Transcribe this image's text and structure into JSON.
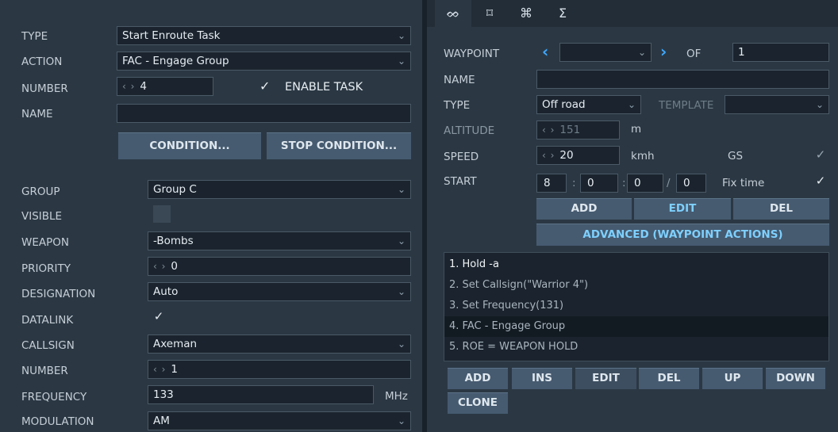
{
  "left": {
    "type": {
      "label": "TYPE",
      "value": "Start Enroute Task"
    },
    "action": {
      "label": "ACTION",
      "value": "FAC - Engage Group"
    },
    "number": {
      "label": "NUMBER",
      "spin": "‹ ›",
      "value": "4"
    },
    "enable_task": {
      "label": "ENABLE TASK",
      "checked": true
    },
    "name": {
      "label": "NAME",
      "value": ""
    },
    "condition_button": "CONDITION...",
    "stop_condition_button": "STOP CONDITION...",
    "group": {
      "label": "GROUP",
      "value": "Group C"
    },
    "visible": {
      "label": "VISIBLE",
      "checked": false
    },
    "weapon": {
      "label": "WEAPON",
      "value": "-Bombs"
    },
    "priority": {
      "label": "PRIORITY",
      "spin": "‹ ›",
      "value": "0"
    },
    "designation": {
      "label": "DESIGNATION",
      "value": "Auto"
    },
    "datalink": {
      "label": "DATALINK",
      "checked": true
    },
    "callsign": {
      "label": "CALLSIGN",
      "value": "Axeman"
    },
    "callsign_number": {
      "label": "NUMBER",
      "spin": "‹ ›",
      "value": "1"
    },
    "frequency": {
      "label": "FREQUENCY",
      "value": "133",
      "unit": "MHz"
    },
    "modulation": {
      "label": "MODULATION",
      "value": "AM"
    }
  },
  "right": {
    "tabs": [
      {
        "icon": "route-icon",
        "glyph": "ᨖ"
      },
      {
        "icon": "target-icon",
        "glyph": "⌑"
      },
      {
        "icon": "command-icon",
        "glyph": "⌘"
      },
      {
        "icon": "sigma-icon",
        "glyph": "Σ"
      }
    ],
    "waypoint": {
      "label": "WAYPOINT",
      "value": "",
      "of_label": "OF",
      "total": "1"
    },
    "name": {
      "label": "NAME",
      "value": ""
    },
    "type": {
      "label": "TYPE",
      "value": "Off road",
      "template_label": "TEMPLATE",
      "template_value": ""
    },
    "altitude": {
      "label": "ALTITUDE",
      "spin": "‹ ›",
      "value": "151",
      "unit": "m"
    },
    "speed": {
      "label": "SPEED",
      "spin": "‹ ›",
      "value": "20",
      "unit": "kmh",
      "gs_label": "GS",
      "gs_checked": true
    },
    "start": {
      "label": "START",
      "h": "8",
      "m": "0",
      "s": "0",
      "d": "0",
      "sep1": ":",
      "sep2": ":",
      "sep3": "/",
      "fix_label": "Fix time",
      "fix_checked": true
    },
    "wp_buttons": {
      "add": "ADD",
      "edit": "EDIT",
      "del": "DEL"
    },
    "advanced_button": "ADVANCED (WAYPOINT ACTIONS)",
    "actions": [
      "1. Hold -a",
      "2. Set Callsign(\"Warrior 4\")",
      "3. Set Frequency(131)",
      "4. FAC - Engage Group",
      "5. ROE = WEAPON HOLD"
    ],
    "action_buttons": {
      "add": "ADD",
      "ins": "INS",
      "edit": "EDIT",
      "del": "DEL",
      "up": "UP",
      "down": "DOWN",
      "clone": "CLONE"
    }
  },
  "colors": {
    "panel": "#2b3844",
    "field": "#1b242e",
    "button": "#465b70",
    "accent": "#3fa9ff",
    "blue_text": "#7ed0ff"
  }
}
